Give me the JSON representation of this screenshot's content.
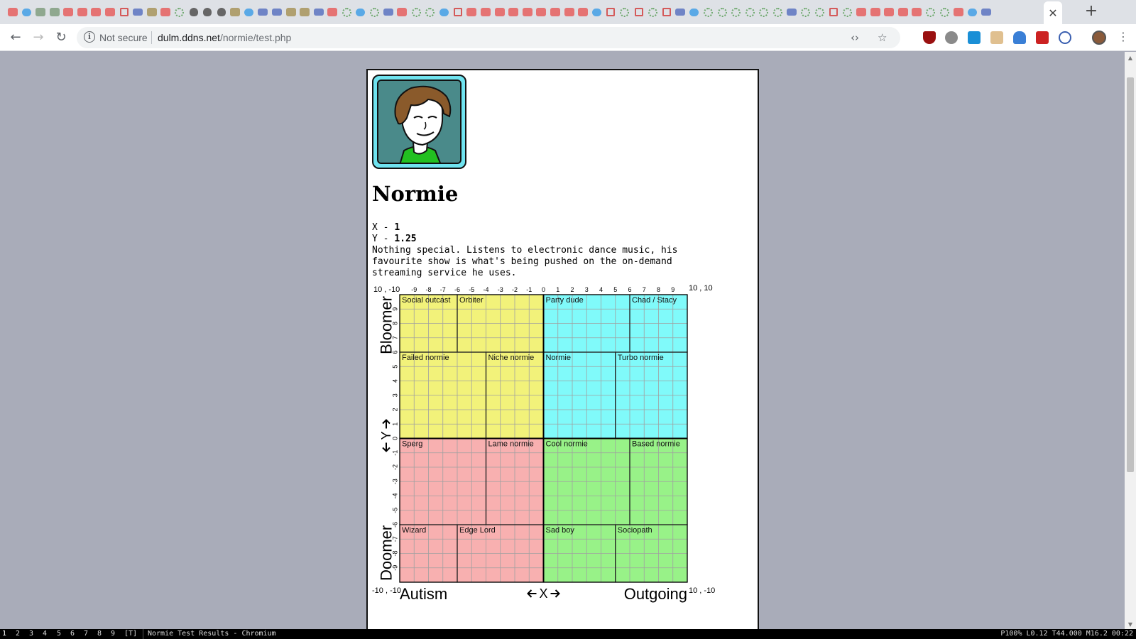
{
  "browser": {
    "tab_favicons": [
      "yt",
      "tw",
      "pt",
      "pt",
      "yt",
      "yt",
      "yt",
      "yt",
      "rs",
      "bl",
      "gy",
      "yt",
      "gr",
      "pw",
      "pw",
      "pw",
      "gy",
      "tw",
      "bl",
      "bl",
      "gy",
      "gy",
      "bl",
      "yt",
      "gr",
      "tw",
      "gr",
      "bl",
      "yt",
      "gr",
      "gr",
      "tw",
      "rs",
      "yt",
      "yt",
      "yt",
      "yt",
      "yt",
      "yt",
      "yt",
      "yt",
      "yt",
      "tw",
      "rs",
      "gr",
      "rs",
      "gr",
      "rs",
      "bl",
      "tw",
      "gr",
      "gr",
      "gr",
      "gr",
      "gr",
      "gr",
      "bl",
      "gr",
      "gr",
      "rs",
      "gr",
      "yt",
      "yt",
      "yt",
      "yt",
      "yt",
      "gr",
      "gr",
      "yt",
      "tw",
      "bl"
    ],
    "active_tab_close": "✕",
    "new_tab": "+",
    "nav": {
      "back": "←",
      "forward": "→",
      "reload": "↻"
    },
    "address": {
      "info_icon": "i",
      "security_label": "Not secure",
      "host": "dulm.ddns.net",
      "path": "/normie/test.php"
    },
    "menu_icon": "⋮"
  },
  "page": {
    "portrait_alt": "Normie portrait",
    "result_name": "Normie",
    "x_label": "X - ",
    "x_value": "1",
    "y_label": "Y - ",
    "y_value": "1.25",
    "description": "Nothing special. Listens to electronic dance music, his\nfavourite show is what's being pushed on the on-demand\nstreaming service he uses."
  },
  "chart_data": {
    "type": "quadrant-compass",
    "title": "",
    "xlim": [
      -10,
      10
    ],
    "ylim": [
      -10,
      10
    ],
    "x_ticks": [
      -9,
      -8,
      -7,
      -6,
      -5,
      -4,
      -3,
      -2,
      -1,
      0,
      1,
      2,
      3,
      4,
      5,
      6,
      7,
      8,
      9
    ],
    "y_ticks": [
      9,
      8,
      7,
      6,
      5,
      4,
      3,
      2,
      1,
      0,
      -1,
      -2,
      -3,
      -4,
      -5,
      -6,
      -7,
      -8,
      -9
    ],
    "corner_labels": {
      "top_left": "10 , -10",
      "top_right": "10 , 10",
      "bottom_left": "-10 , -10",
      "bottom_right": "10 , -10"
    },
    "x_axis": {
      "negative": "Autism",
      "positive": "Outgoing",
      "symbol": "X"
    },
    "y_axis": {
      "positive": "Bloomer",
      "negative": "Doomer",
      "symbol": "Y"
    },
    "quadrant_colors": {
      "top_left": "#f2f27a",
      "top_right": "#80fafa",
      "bottom_left": "#f8b0b0",
      "bottom_right": "#98f288"
    },
    "regions": [
      {
        "label": "Social outcast",
        "x0": -10,
        "x1": -6,
        "y0": 6,
        "y1": 10
      },
      {
        "label": "Orbiter",
        "x0": -6,
        "x1": 0,
        "y0": 6,
        "y1": 10
      },
      {
        "label": "Failed normie",
        "x0": -10,
        "x1": -4,
        "y0": 0,
        "y1": 6
      },
      {
        "label": "Niche normie",
        "x0": -4,
        "x1": 0,
        "y0": 0,
        "y1": 6
      },
      {
        "label": "Party dude",
        "x0": 0,
        "x1": 6,
        "y0": 6,
        "y1": 10
      },
      {
        "label": "Chad / Stacy",
        "x0": 6,
        "x1": 10,
        "y0": 6,
        "y1": 10
      },
      {
        "label": "Normie",
        "x0": 0,
        "x1": 5,
        "y0": 0,
        "y1": 6
      },
      {
        "label": "Turbo normie",
        "x0": 5,
        "x1": 10,
        "y0": 0,
        "y1": 6
      },
      {
        "label": "Sperg",
        "x0": -10,
        "x1": -4,
        "y0": -6,
        "y1": 0
      },
      {
        "label": "Lame normie",
        "x0": -4,
        "x1": 0,
        "y0": -6,
        "y1": 0
      },
      {
        "label": "Cool normie",
        "x0": 0,
        "x1": 6,
        "y0": -6,
        "y1": 0
      },
      {
        "label": "Based normie",
        "x0": 6,
        "x1": 10,
        "y0": -6,
        "y1": 0
      },
      {
        "label": "Wizard",
        "x0": -10,
        "x1": -6,
        "y0": -10,
        "y1": -6
      },
      {
        "label": "Edge Lord",
        "x0": -6,
        "x1": 0,
        "y0": -10,
        "y1": -6
      },
      {
        "label": "Sad boy",
        "x0": 0,
        "x1": 5,
        "y0": -10,
        "y1": -6
      },
      {
        "label": "Sociopath",
        "x0": 5,
        "x1": 10,
        "y0": -10,
        "y1": -6
      }
    ]
  },
  "statusbar": {
    "workspaces": [
      "1",
      "2",
      "3",
      "4",
      "5",
      "6",
      "7",
      "8",
      "9",
      "[T]"
    ],
    "active_workspace": "1",
    "window_title": "Normie Test Results - Chromium",
    "right_info": "P100% L0.12 T44.000 M16.2 00:22"
  }
}
